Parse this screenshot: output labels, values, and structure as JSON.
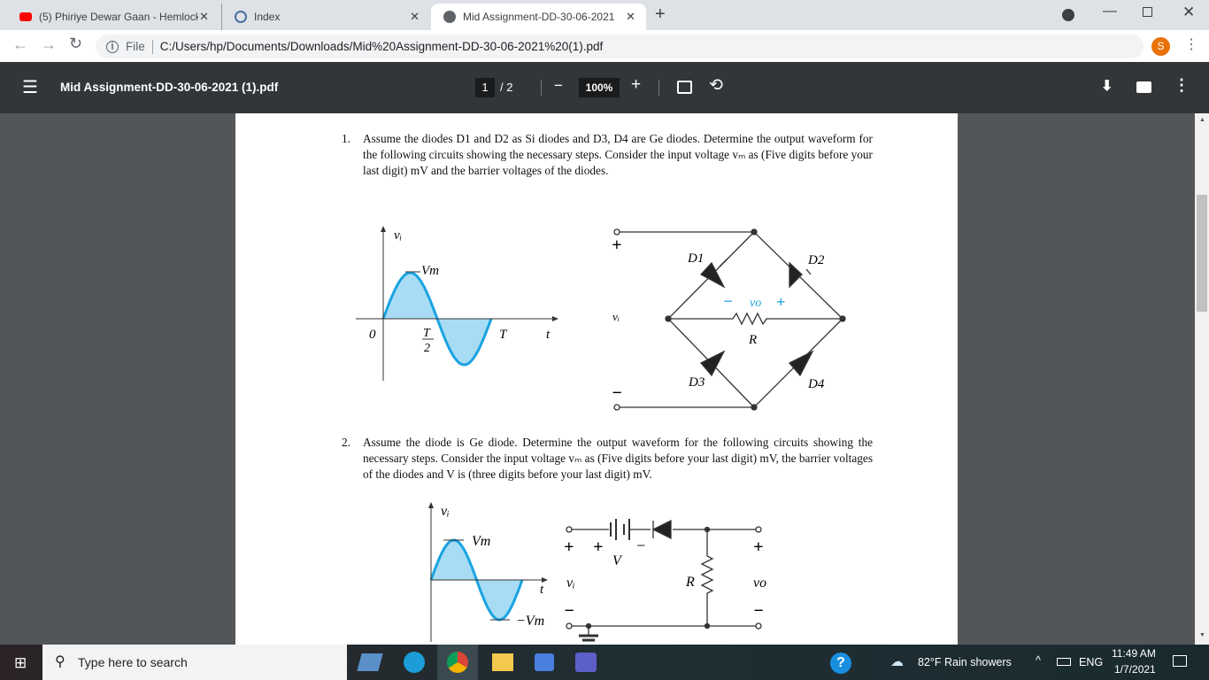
{
  "tabs": [
    {
      "title": "(5) Phiriye Dewar Gaan - Hemlock",
      "icon": "youtube-icon"
    },
    {
      "title": "Index",
      "icon": "globe-icon"
    },
    {
      "title": "Mid Assignment-DD-30-06-2021",
      "icon": "globe-icon",
      "active": true
    }
  ],
  "address": {
    "security": "File",
    "url": "C:/Users/hp/Documents/Downloads/Mid%20Assignment-DD-30-06-2021%20(1).pdf"
  },
  "profile_initial": "S",
  "pdf": {
    "title": "Mid Assignment-DD-30-06-2021 (1).pdf",
    "page_current": "1",
    "page_total": "/ 2",
    "zoom": "100%"
  },
  "questions": [
    {
      "num": "1.",
      "text": "Assume the diodes D1 and D2 as Si diodes and D3, D4 are Ge diodes. Determine the output waveform for the following circuits showing the necessary steps. Consider the input voltage vₘ as (Five digits before your last digit) mV and the barrier voltages of the diodes."
    },
    {
      "num": "2.",
      "text": "Assume the diode is Ge diode. Determine the output waveform for the following circuits showing the necessary steps. Consider the input voltage vₘ as (Five digits before your last digit) mV, the barrier voltages of the diodes and V is (three digits before your last digit) mV."
    }
  ],
  "fig1": {
    "vi": "vᵢ",
    "vm": "Vm",
    "zero": "0",
    "t_half_num": "T",
    "t_half_den": "2",
    "T": "T",
    "t": "t",
    "plus": "+",
    "minus": "−",
    "vi_term": "vᵢ",
    "d1": "D1",
    "d2": "D2",
    "d3": "D3",
    "d4": "D4",
    "vo": "vo",
    "R": "R"
  },
  "fig2": {
    "vi": "vᵢ",
    "vm": "Vm",
    "neg_vm": "−Vm",
    "t": "t",
    "V": "V",
    "R": "R",
    "vo": "vo",
    "plus": "+",
    "minus": "−"
  },
  "taskbar": {
    "search_placeholder": "Type here to search",
    "weather": "82°F  Rain showers",
    "lang": "ENG",
    "time": "11:49 AM",
    "date": "1/7/2021"
  },
  "colors": {
    "wave": "#1aa3e0",
    "fill": "#a8dcf5",
    "toolbar": "#323639",
    "accent": "#e8710a"
  }
}
